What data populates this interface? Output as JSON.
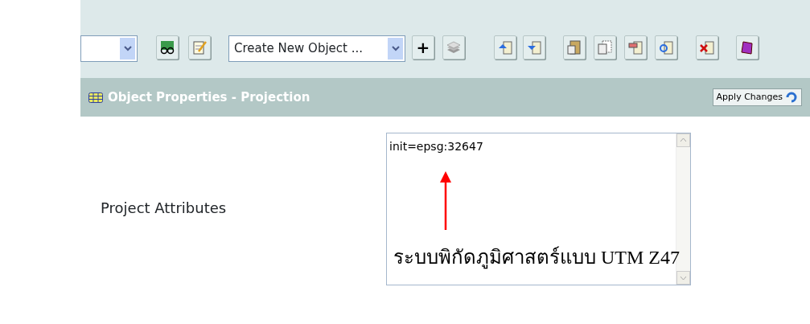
{
  "toolbar": {
    "object_select": {
      "value": "Create New Object ..."
    },
    "add_button": {
      "label": "+"
    }
  },
  "header": {
    "title": "Object Properties - Projection",
    "apply_button": {
      "label": "Apply Changes"
    }
  },
  "form": {
    "label": "Project Attributes",
    "value": "init=epsg:32647"
  },
  "annotation": {
    "text": "ระบบพิกัดภูมิศาสตร์แบบ UTM Z47"
  }
}
